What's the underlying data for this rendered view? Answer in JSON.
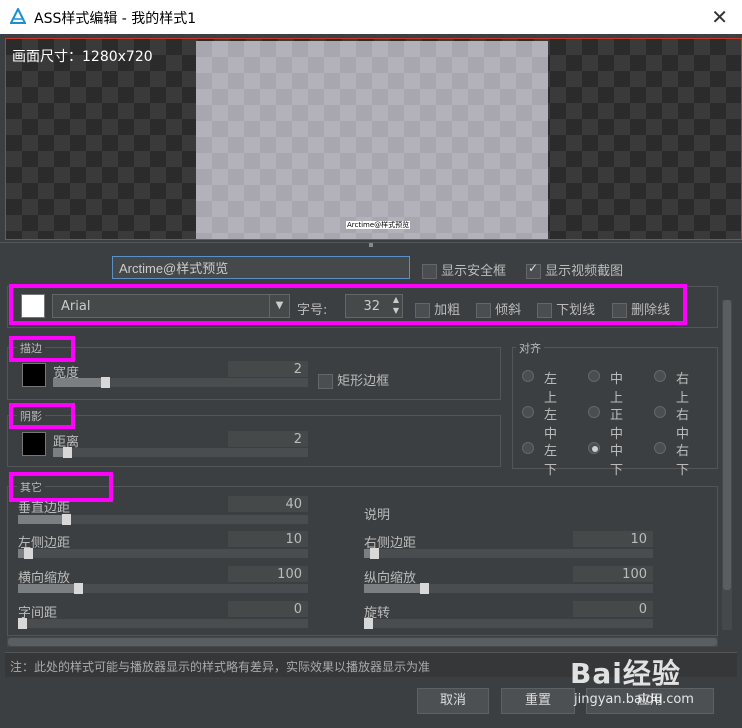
{
  "window": {
    "title": "ASS样式编辑 - 我的样式1"
  },
  "preview": {
    "canvas_size": "画面尺寸：1280x720",
    "subtitle_preview": "Arctime@样式预览"
  },
  "style_name": {
    "value": "Arctime@样式预览"
  },
  "options": {
    "show_safe_frame": "显示安全框",
    "show_video_frame": "显示视频截图"
  },
  "font": {
    "name": "Arial",
    "size_label": "字号:",
    "size": "32",
    "bold": "加粗",
    "italic": "倾斜",
    "underline": "下划线",
    "strikeout": "删除线",
    "color": "#ffffff"
  },
  "stroke": {
    "legend": "描边",
    "width_label": "宽度",
    "width": "2",
    "width_level": 0.2,
    "rect_border": "矩形边框",
    "color": "#000000"
  },
  "shadow": {
    "legend": "阴影",
    "distance_label": "距离",
    "distance": "2",
    "distance_level": 0.2,
    "color": "#000000"
  },
  "align": {
    "legend": "对齐",
    "options": [
      "左上",
      "中上",
      "右上",
      "左中",
      "正中",
      "右中",
      "左下",
      "中下",
      "右下"
    ],
    "selected": "中下"
  },
  "other": {
    "legend": "其它",
    "vertical_margin_label": "垂直边距",
    "vertical_margin": "40",
    "vertical_margin_level": 0.18,
    "description_label": "说明",
    "left_margin_label": "左侧边距",
    "left_margin": "10",
    "left_margin_level": 0.05,
    "right_margin_label": "右侧边距",
    "right_margin": "10",
    "right_margin_level": 0.05,
    "scale_x_label": "横向缩放",
    "scale_x": "100",
    "scale_x_level": 0.2,
    "scale_y_label": "纵向缩放",
    "scale_y": "100",
    "scale_y_level": 0.2,
    "spacing_label": "字间距",
    "spacing": "0",
    "spacing_level": 0.0,
    "rotation_label": "旋转",
    "rotation": "0",
    "rotation_level": 0.0
  },
  "note": "注：此处的样式可能与播放器显示的样式略有差异，实际效果以播放器显示为准",
  "buttons": {
    "cancel": "取消",
    "reset": "重置",
    "apply": "应用"
  },
  "watermark": {
    "brand": "Bai经验",
    "url": "jingyan.baidu.com"
  }
}
